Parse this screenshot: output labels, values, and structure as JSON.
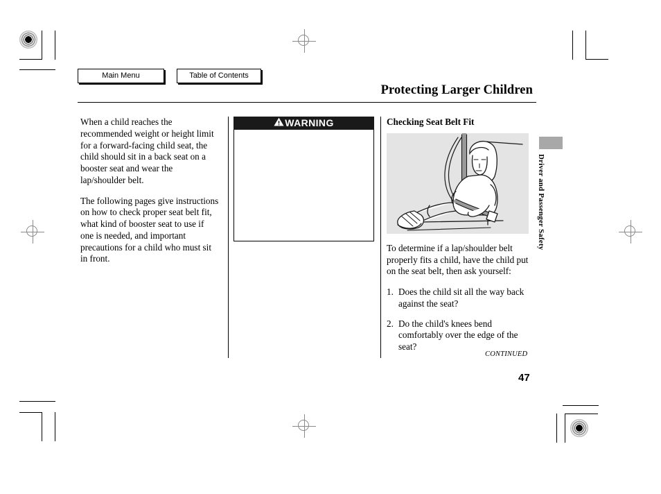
{
  "nav": {
    "main_menu_label": "Main Menu",
    "table_of_contents_label": "Table of Contents"
  },
  "header": {
    "title": "Protecting Larger Children"
  },
  "left_column": {
    "paragraph_1": "When a child reaches the recommended weight or height limit for a forward-facing child seat, the child should sit in a back seat on a booster seat and wear the lap/shoulder belt.",
    "paragraph_2": "The following pages give instructions on how to check proper seat belt fit, what kind of booster seat to use if one is needed, and important precautions for a child who must sit in front."
  },
  "warning": {
    "title": "WARNING",
    "body": ""
  },
  "right_column": {
    "heading": "Checking Seat Belt Fit",
    "figure_alt": "Child seated in vehicle seat wearing a lap/shoulder belt",
    "paragraph_1": "To determine if a lap/shoulder belt properly fits a child, have the child put on the seat belt, then ask yourself:",
    "questions": [
      {
        "number": "1.",
        "text": "Does the child sit all the way back against the seat?"
      },
      {
        "number": "2.",
        "text": "Do the child's knees bend comfortably over the edge of the seat?"
      }
    ],
    "continued_label": "CONTINUED"
  },
  "side_tab": {
    "label": "Driver and Passenger Safety"
  },
  "footer": {
    "page_number": "47"
  },
  "colors": {
    "warning_bar": "#1a1a1a",
    "warning_text": "#ffffff",
    "figure_background": "#e4e4e4",
    "side_tab_block": "#a8a8a8",
    "rule": "#000000"
  }
}
